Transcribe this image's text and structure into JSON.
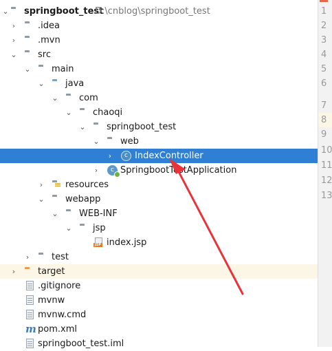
{
  "project_tree": {
    "root_name": "springboot_test",
    "root_path": "D:\\cnblog\\springboot_test",
    "items": [
      {
        "label": ".idea",
        "icon": "folder-icon"
      },
      {
        "label": ".mvn",
        "icon": "folder-icon"
      },
      {
        "label": "src",
        "icon": "folder-icon"
      },
      {
        "label": "main",
        "icon": "folder-icon"
      },
      {
        "label": "java",
        "icon": "source-folder-icon"
      },
      {
        "label": "com",
        "icon": "package-icon"
      },
      {
        "label": "chaoqi",
        "icon": "package-icon"
      },
      {
        "label": "springboot_test",
        "icon": "package-icon"
      },
      {
        "label": "web",
        "icon": "package-icon"
      },
      {
        "label": "IndexController",
        "icon": "class-icon",
        "state": "selected"
      },
      {
        "label": "SpringbootTestApplication",
        "icon": "spring-boot-class-icon"
      },
      {
        "label": "resources",
        "icon": "resources-folder-icon"
      },
      {
        "label": "webapp",
        "icon": "folder-icon"
      },
      {
        "label": "WEB-INF",
        "icon": "folder-icon"
      },
      {
        "label": "jsp",
        "icon": "folder-icon"
      },
      {
        "label": "index.jsp",
        "icon": "jsp-file-icon"
      },
      {
        "label": "test",
        "icon": "folder-icon"
      },
      {
        "label": "target",
        "icon": "excluded-folder-icon"
      },
      {
        "label": ".gitignore",
        "icon": "text-file-icon"
      },
      {
        "label": "mvnw",
        "icon": "text-file-icon"
      },
      {
        "label": "mvnw.cmd",
        "icon": "text-file-icon"
      },
      {
        "label": "pom.xml",
        "icon": "maven-icon"
      },
      {
        "label": "springboot_test.iml",
        "icon": "text-file-icon"
      }
    ]
  },
  "editor_gutter": {
    "line_numbers": [
      "1",
      "2",
      "3",
      "4",
      "5",
      "6",
      "7",
      "8",
      "9",
      "10",
      "11",
      "12",
      "13"
    ],
    "highlighted_line": "8"
  },
  "colors": {
    "selection": "#2f7fd4",
    "highlight_row": "#fcf6e7",
    "annotation_arrow": "#e8333a",
    "source_folder": "#6ba8de",
    "excluded_folder": "#e99a55"
  }
}
